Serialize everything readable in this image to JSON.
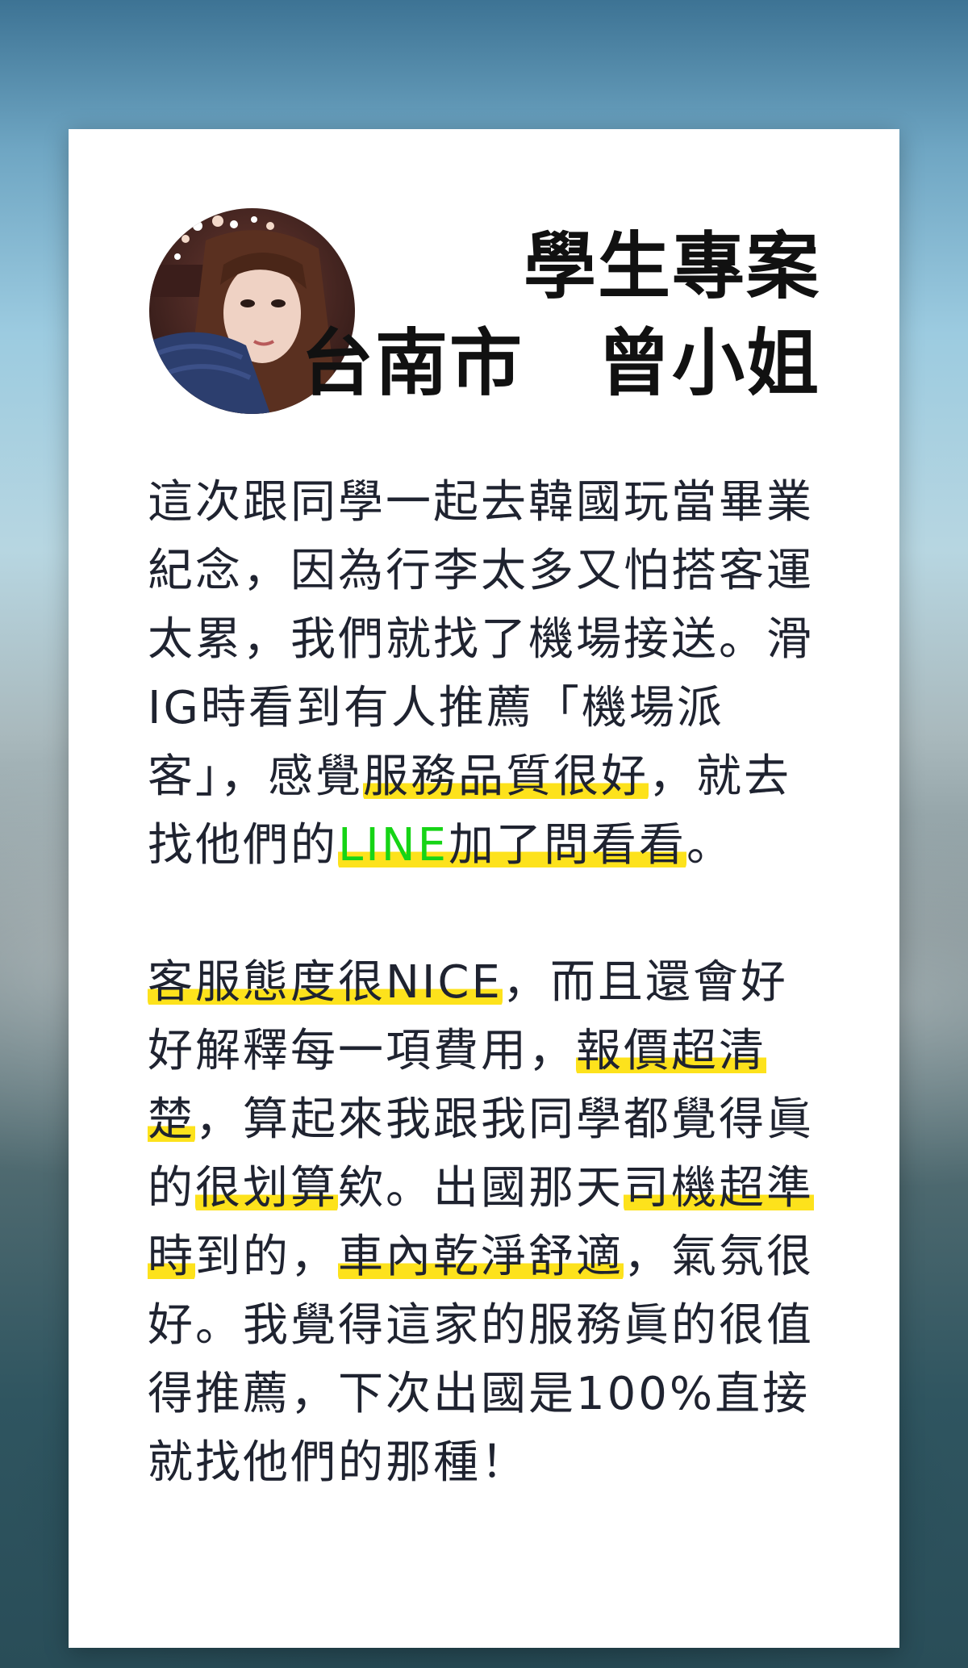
{
  "profile": {
    "plan": "學生專案",
    "location_name": "台南市　曾小姐"
  },
  "review": {
    "p1_a": "這次跟同學一起去韓國玩當畢業紀念，因為行李太多又怕搭客運太累，我們就找了機場接送。滑IG時看到有人推薦「機場派客」，感覺",
    "p1_hl1": "服務品質很好",
    "p1_b": "，就去找他們的",
    "p1_line": "LINE",
    "p1_hl2": "加了問看看",
    "p1_c": "。",
    "p2_hl1": "客服態度很NICE",
    "p2_a": "，而且還會好好解釋每一項費用，",
    "p2_hl2": "報價超清楚",
    "p2_b": "，算起來我跟我同學都覺得眞的",
    "p2_hl3": "很划算",
    "p2_c": "欸。出國那天",
    "p2_hl4": "司機超準時",
    "p2_d": "到的，",
    "p2_hl5": "車內乾淨舒適",
    "p2_e": "，氣氛很好。我覺得這家的服務眞的很值得推薦，下次出國是100%直接就找他們的那種！"
  },
  "colors": {
    "highlight": "#fde21c",
    "line_brand": "#16d416",
    "text": "#1f2330"
  }
}
